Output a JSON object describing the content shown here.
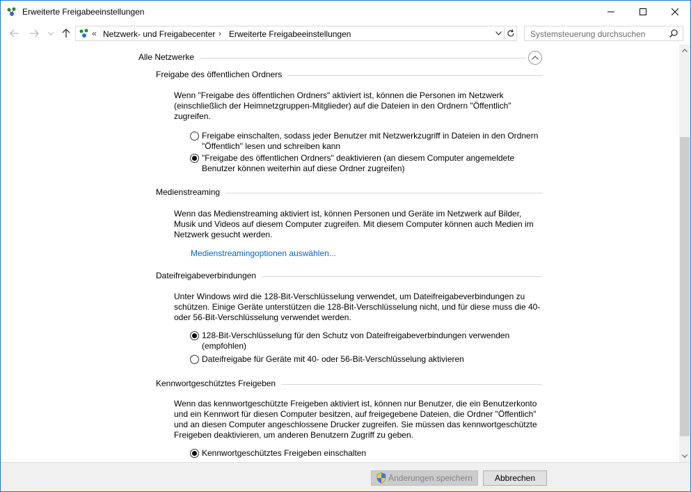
{
  "window": {
    "title": "Erweiterte Freigabeeinstellungen",
    "icon": "network-sharing-icon"
  },
  "address": {
    "overflow": "«",
    "crumbs": [
      "Netzwerk- und Freigabecenter",
      "Erweiterte Freigabeeinstellungen"
    ],
    "separator": "›",
    "search_placeholder": "Systemsteuerung durchsuchen"
  },
  "group": {
    "title": "Alle Netzwerke"
  },
  "sections": {
    "public_folder": {
      "title": "Freigabe des öffentlichen Ordners",
      "description": "Wenn \"Freigabe des öffentlichen Ordners\" aktiviert ist, können die Personen im Netzwerk (einschließlich der Heimnetzgruppen-Mitglieder) auf die Dateien in den Ordnern \"Öffentlich\" zugreifen.",
      "options": [
        {
          "label": "Freigabe einschalten, sodass jeder Benutzer mit Netzwerkzugriff in Dateien in den Ordnern \"Öffentlich\" lesen und schreiben kann",
          "checked": false
        },
        {
          "label": "\"Freigabe des öffentlichen Ordners\" deaktivieren (an diesem Computer angemeldete Benutzer können weiterhin auf diese Ordner zugreifen)",
          "checked": true
        }
      ]
    },
    "media_streaming": {
      "title": "Medienstreaming",
      "description": "Wenn das Medienstreaming aktiviert ist, können Personen und Geräte im Netzwerk auf Bilder, Musik und Videos auf diesem Computer zugreifen. Mit diesem Computer können auch Medien im Netzwerk gesucht werden.",
      "link": "Medienstreamingoptionen auswählen..."
    },
    "file_sharing": {
      "title": "Dateifreigabeverbindungen",
      "description": "Unter Windows wird die 128-Bit-Verschlüsselung verwendet, um Dateifreigabeverbindungen zu schützen. Einige Geräte unterstützen die 128-Bit-Verschlüsselung nicht, und für diese muss die 40- oder 56-Bit-Verschlüsselung verwendet werden.",
      "options": [
        {
          "label": "128-Bit-Verschlüsselung für den Schutz von Dateifreigabeverbindungen verwenden (empfohlen)",
          "checked": true
        },
        {
          "label": "Dateifreigabe für Geräte mit 40- oder 56-Bit-Verschlüsselung aktivieren",
          "checked": false
        }
      ]
    },
    "password": {
      "title": "Kennwortgeschütztes Freigeben",
      "description": "Wenn das kennwortgeschützte Freigeben aktiviert ist, können nur Benutzer, die ein Benutzerkonto und ein Kennwort für diesen Computer besitzen, auf freigegebene Dateien, die Ordner \"Öffentlich\" und an diesen Computer angeschlossene Drucker zugreifen. Sie müssen das kennwortgeschützte Freigeben deaktivieren, um anderen Benutzern Zugriff zu geben.",
      "options": [
        {
          "label": "Kennwortgeschütztes Freigeben einschalten",
          "checked": true
        }
      ]
    }
  },
  "footer": {
    "save_label": "Änderungen speichern",
    "cancel_label": "Abbrechen"
  },
  "colors": {
    "accent_border": "#1979ca",
    "link": "#0066cc"
  }
}
